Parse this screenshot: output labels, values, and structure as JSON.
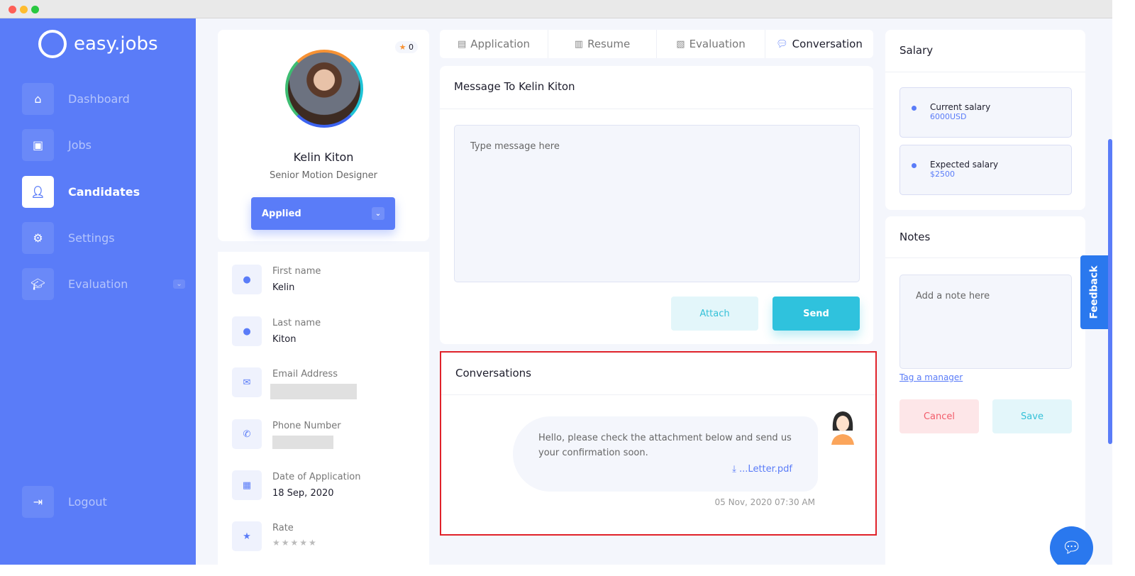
{
  "brand": {
    "name": "easy.jobs",
    "color": "#5a7cf8"
  },
  "sidebar": {
    "items": [
      {
        "label": "Dashboard",
        "icon": "home-icon"
      },
      {
        "label": "Jobs",
        "icon": "briefcase-icon"
      },
      {
        "label": "Candidates",
        "icon": "user-icon",
        "active": true
      },
      {
        "label": "Settings",
        "icon": "gear-icon"
      },
      {
        "label": "Evaluation",
        "icon": "graduation-cap-icon"
      }
    ],
    "logout": "Logout"
  },
  "profile": {
    "rating_count": "0",
    "name": "Kelin Kiton",
    "role": "Senior Motion Designer",
    "status": "Applied"
  },
  "details": {
    "first_name_label": "First name",
    "first_name": "Kelin",
    "last_name_label": "Last name",
    "last_name": "Kiton",
    "email_label": "Email Address",
    "phone_label": "Phone Number",
    "date_label": "Date of Application",
    "date": "18 Sep, 2020",
    "rate_label": "Rate",
    "rate": 0
  },
  "tabs": [
    {
      "label": "Application"
    },
    {
      "label": "Resume"
    },
    {
      "label": "Evaluation"
    },
    {
      "label": "Conversation",
      "active": true
    }
  ],
  "message": {
    "title": "Message To Kelin Kiton",
    "placeholder": "Type message here",
    "attach": "Attach",
    "send": "Send"
  },
  "conversations": {
    "title": "Conversations",
    "text": "Hello, please check the attachment below and send us your confirmation soon.",
    "attachment": "...Letter.pdf",
    "timestamp": "05 Nov, 2020 07:30 AM"
  },
  "salary": {
    "title": "Salary",
    "current_label": "Current salary",
    "current": "6000USD",
    "expected_label": "Expected salary",
    "expected": "$2500"
  },
  "notes": {
    "title": "Notes",
    "placeholder": "Add a note here",
    "tag": "Tag a manager",
    "cancel": "Cancel",
    "save": "Save"
  },
  "feedback": "Feedback"
}
